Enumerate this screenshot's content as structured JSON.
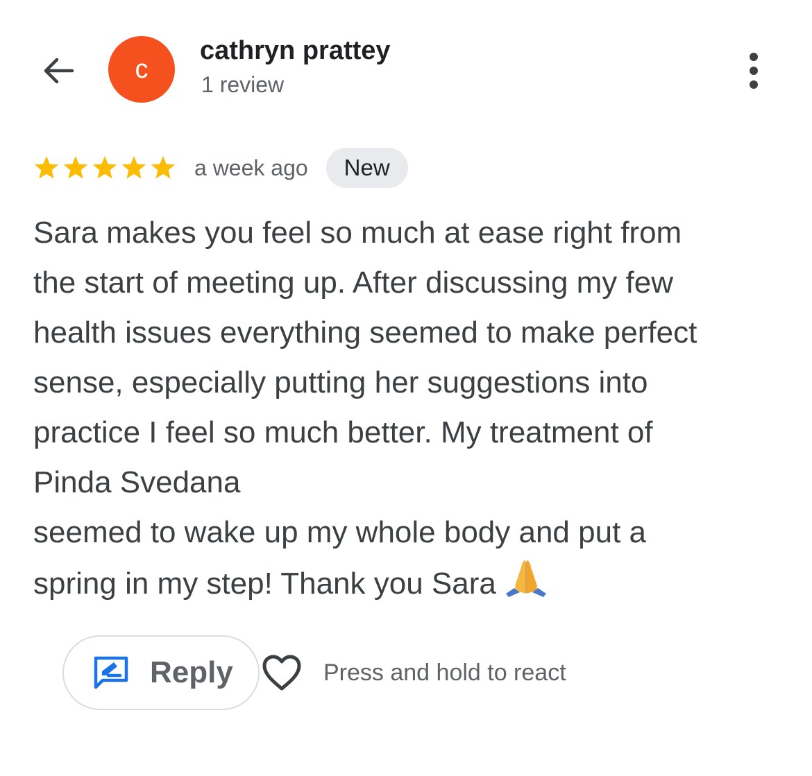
{
  "header": {
    "back_icon": "arrow-back-icon",
    "avatar_letter": "c",
    "avatar_color": "#F4511E",
    "reviewer_name": "cathryn prattey",
    "review_count": "1 review",
    "more_icon": "more-vert-icon"
  },
  "review": {
    "rating": 5,
    "rating_max": 5,
    "star_color": "#FBBC04",
    "date": "a week ago",
    "badge": "New",
    "lines": [
      "Sara makes you feel so much at ease right from",
      "the start of meeting up. After discussing my few",
      "health issues everything seemed to make perfect",
      "sense, especially putting her suggestions into",
      "practice I feel so much better. My treatment of",
      "Pinda Svedana",
      "seemed to wake up my whole body and put a",
      "spring in my step! Thank you Sara"
    ],
    "emoji": "folded-hands-icon"
  },
  "actions": {
    "reply_icon": "reply-edit-icon",
    "reply_label": "Reply",
    "reply_icon_color": "#1A73E8",
    "heart_icon": "heart-outline-icon",
    "react_hint": "Press and hold to react"
  }
}
